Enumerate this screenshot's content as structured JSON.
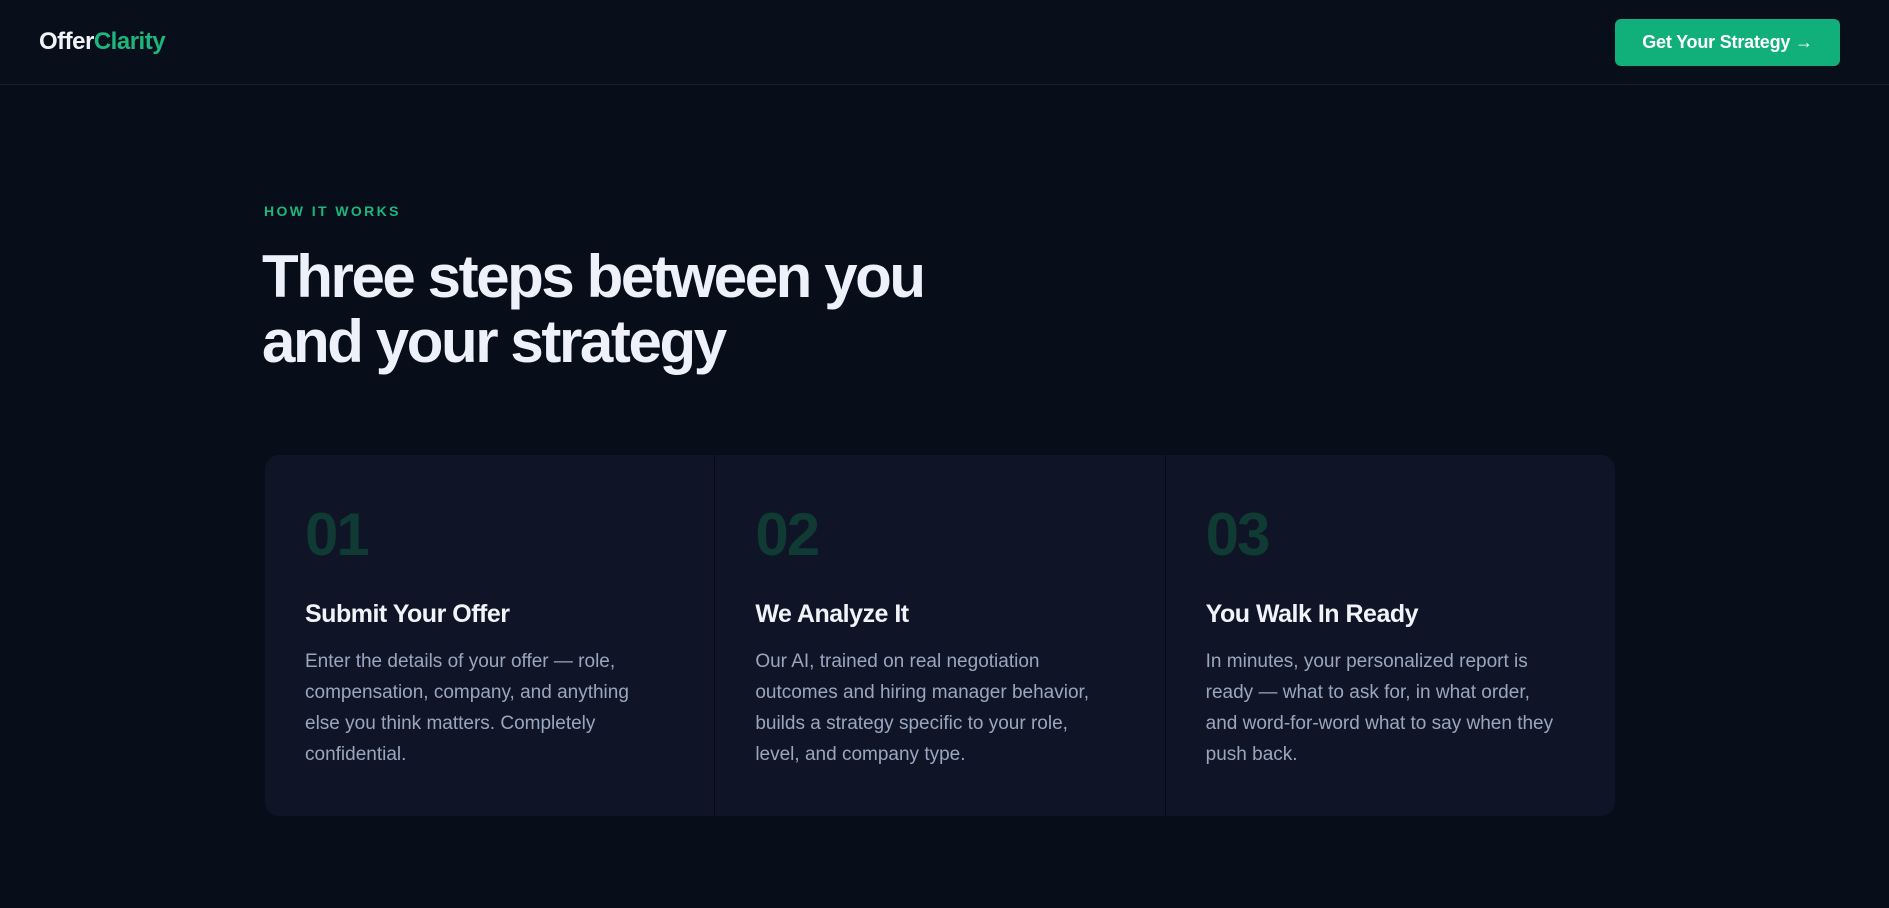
{
  "header": {
    "logo_primary": "Offer",
    "logo_accent": "Clarity",
    "cta_label": "Get Your Strategy →"
  },
  "section": {
    "eyebrow": "HOW IT WORKS",
    "headline_line1": "Three steps between you",
    "headline_line2": "and your strategy"
  },
  "steps": [
    {
      "number": "01",
      "title": "Submit Your Offer",
      "body": "Enter the details of your offer — role, compensation, company, and anything else you think matters. Completely confidential."
    },
    {
      "number": "02",
      "title": "We Analyze It",
      "body": "Our AI, trained on real negotiation outcomes and hiring manager behavior, builds a strategy specific to your role, level, and company type."
    },
    {
      "number": "03",
      "title": "You Walk In Ready",
      "body": "In minutes, your personalized report is ready — what to ask for, in what order, and word-for-word what to say when they push back."
    }
  ],
  "colors": {
    "background": "#080d1a",
    "accent": "#1db67c",
    "button": "#11b07a",
    "card": "#0f1526"
  }
}
